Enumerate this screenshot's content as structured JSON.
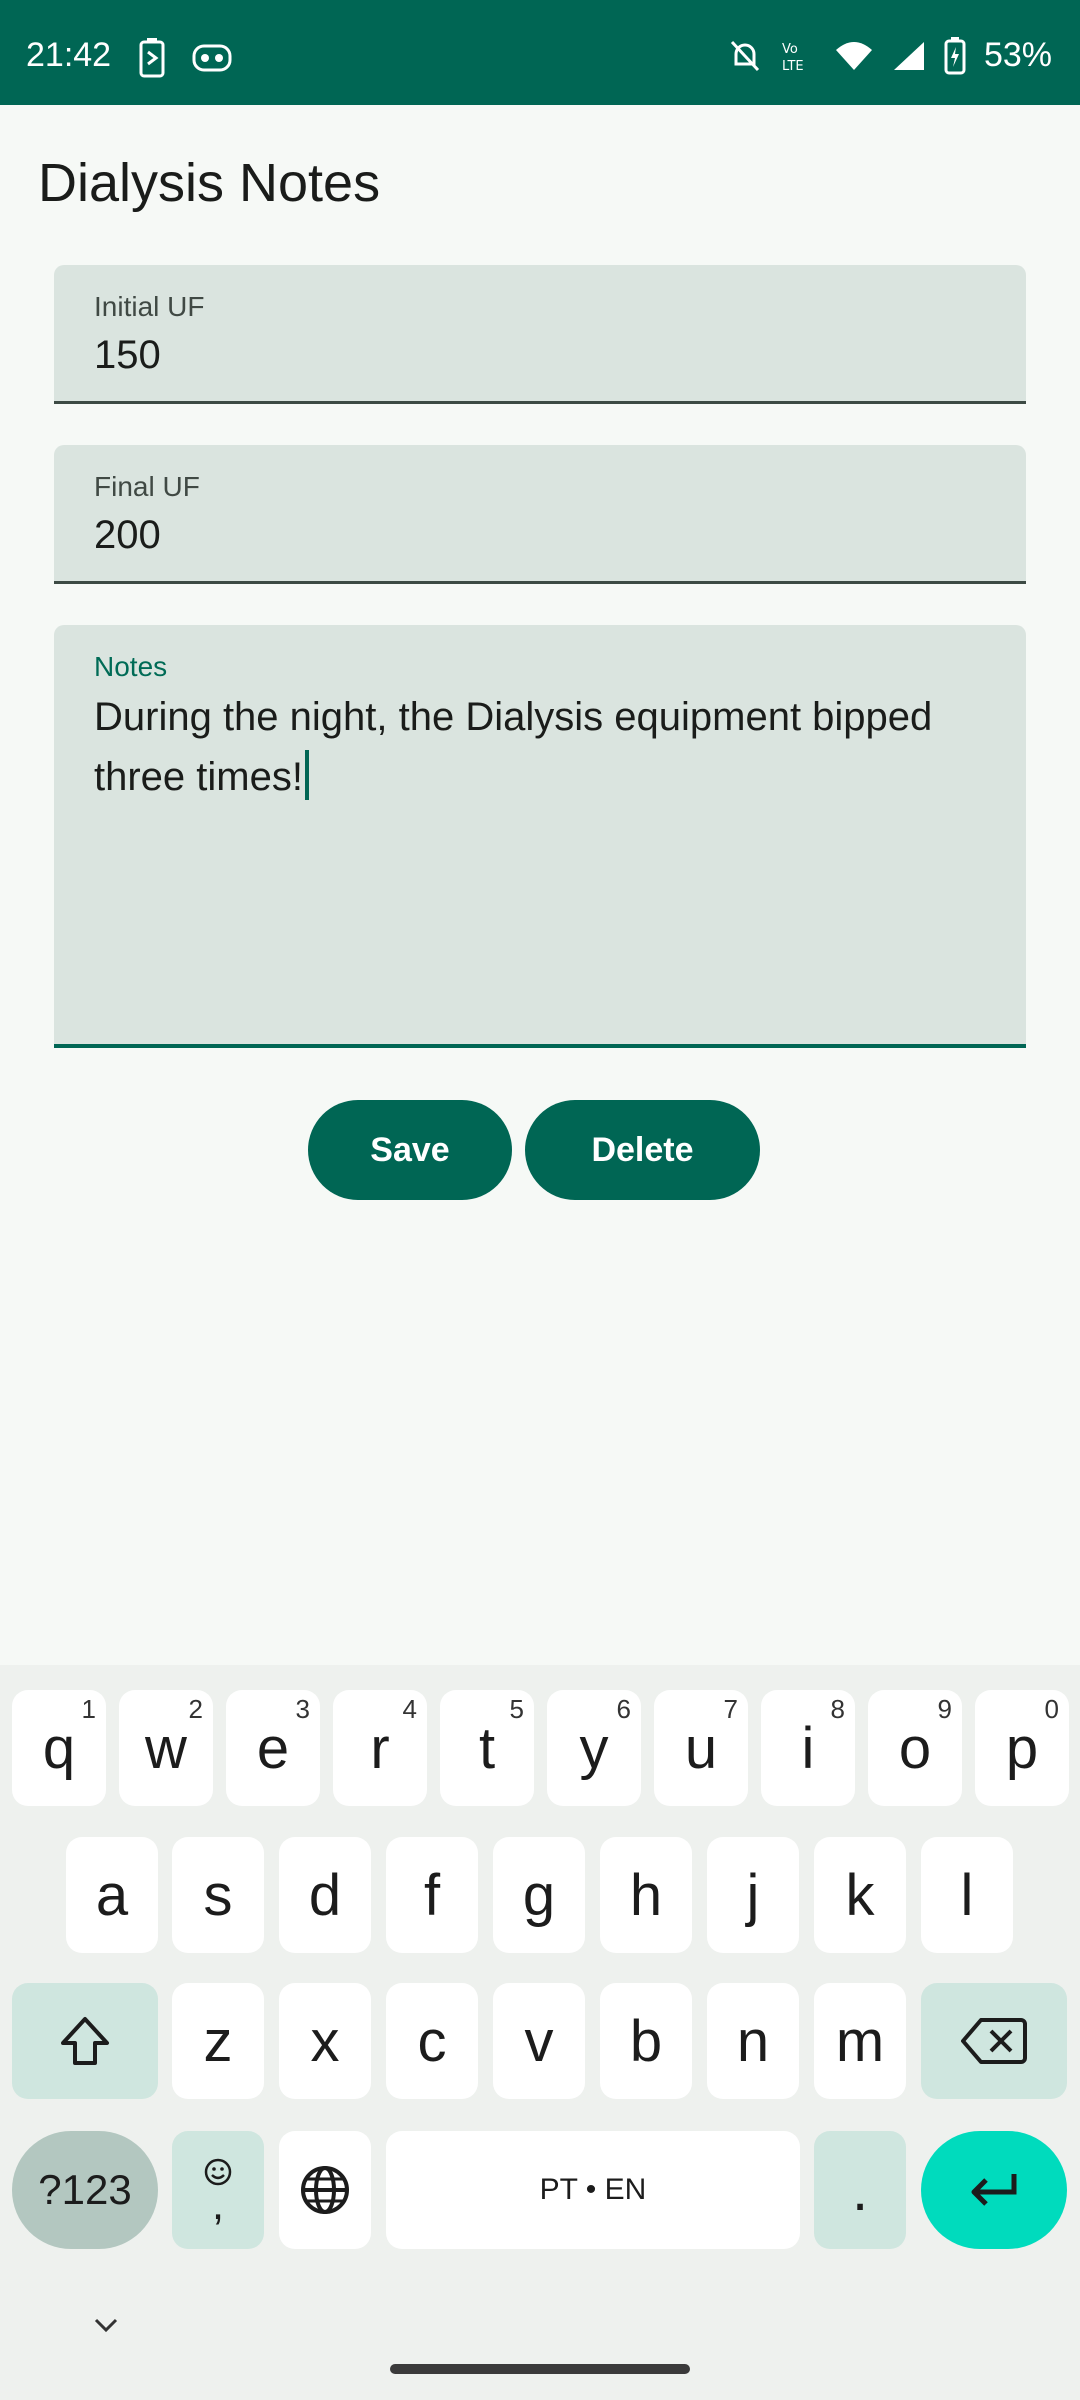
{
  "status": {
    "time": "21:42",
    "battery": "53%",
    "volte_label": "Vo LTE"
  },
  "page": {
    "title": "Dialysis Notes"
  },
  "fields": {
    "initial_uf": {
      "label": "Initial UF",
      "value": "150"
    },
    "final_uf": {
      "label": "Final UF",
      "value": "200"
    },
    "notes": {
      "label": "Notes",
      "value": "During the night, the Dialysis equipment bipped three times!"
    }
  },
  "buttons": {
    "save": "Save",
    "delete": "Delete"
  },
  "keyboard": {
    "row1": [
      {
        "k": "q",
        "h": "1"
      },
      {
        "k": "w",
        "h": "2"
      },
      {
        "k": "e",
        "h": "3"
      },
      {
        "k": "r",
        "h": "4"
      },
      {
        "k": "t",
        "h": "5"
      },
      {
        "k": "y",
        "h": "6"
      },
      {
        "k": "u",
        "h": "7"
      },
      {
        "k": "i",
        "h": "8"
      },
      {
        "k": "o",
        "h": "9"
      },
      {
        "k": "p",
        "h": "0"
      }
    ],
    "row2": [
      "a",
      "s",
      "d",
      "f",
      "g",
      "h",
      "j",
      "k",
      "l"
    ],
    "row3": [
      "z",
      "x",
      "c",
      "v",
      "b",
      "n",
      "m"
    ],
    "symbols": "?123",
    "emoji_comma": ",",
    "space_label": "PT • EN",
    "period": "."
  },
  "icons": {
    "status_left": [
      "battery-saver-icon",
      "assistant-icon"
    ],
    "status_right": [
      "notifications-off-icon",
      "volte-icon",
      "wifi-icon",
      "signal-icon",
      "battery-charging-icon"
    ],
    "keyboard": [
      "shift-icon",
      "backspace-icon",
      "emoji-icon",
      "globe-icon",
      "enter-icon",
      "chevron-down-icon"
    ]
  },
  "colors": {
    "primary": "#006654",
    "field_bg": "#dae4df",
    "enter_key": "#00dbbd"
  }
}
